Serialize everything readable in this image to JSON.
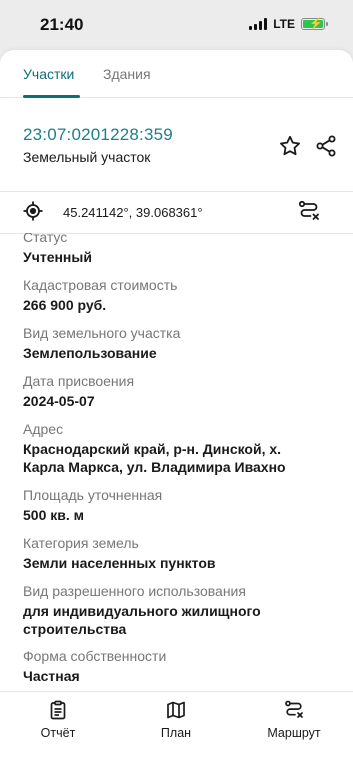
{
  "status_bar": {
    "time": "21:40",
    "network": "LTE"
  },
  "tabs": [
    {
      "label": "Участки",
      "active": true
    },
    {
      "label": "Здания",
      "active": false
    }
  ],
  "parcel": {
    "cadastral_number": "23:07:0201228:359",
    "type": "Земельный участок",
    "coordinates": "45.241142°, 39.068361°"
  },
  "fields": [
    {
      "label": "Статус",
      "value": "Учтенный"
    },
    {
      "label": "Кадастровая стоимость",
      "value": "266 900 руб."
    },
    {
      "label": "Вид земельного участка",
      "value": "Землепользование"
    },
    {
      "label": "Дата присвоения",
      "value": "2024-05-07"
    },
    {
      "label": "Адрес",
      "value_lines": [
        "Краснодарский край, р-н. Динской, х.",
        "Карла Маркса, ул. Владимира Ивахно"
      ]
    },
    {
      "label": "Площадь уточненная",
      "value": "500 кв. м"
    },
    {
      "label": "Категория земель",
      "value": "Земли населенных пунктов"
    },
    {
      "label": "Вид разрешенного использования",
      "value_lines": [
        "для индивидуального жилищного",
        "строительства"
      ]
    },
    {
      "label": "Форма собственности",
      "value": "Частная"
    }
  ],
  "bottom_nav": [
    {
      "label": "Отчёт",
      "icon": "report-icon"
    },
    {
      "label": "План",
      "icon": "map-icon"
    },
    {
      "label": "Маршрут",
      "icon": "route-icon"
    }
  ],
  "colors": {
    "accent": "#0d6e7a",
    "cadastral_link": "#1b7f8c",
    "battery": "#2fc44c"
  }
}
